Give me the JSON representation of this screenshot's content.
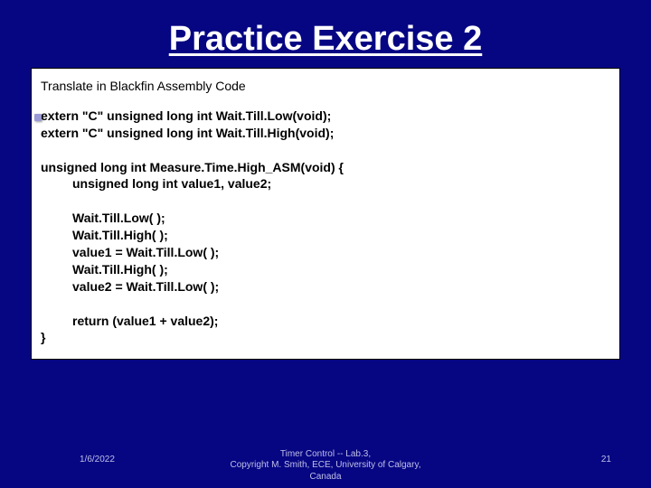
{
  "title": "Practice Exercise 2",
  "instruction": "Translate in Blackfin Assembly Code",
  "code": "extern \"C\" unsigned long int Wait.Till.Low(void);\nextern \"C\" unsigned long int Wait.Till.High(void);\n\nunsigned long int Measure.Time.High_ASM(void) {\n         unsigned long int value1, value2;\n\n         Wait.Till.Low( );\n         Wait.Till.High( );\n         value1 = Wait.Till.Low( );\n         Wait.Till.High( );\n         value2 = Wait.Till.Low( );\n\n         return (value1 + value2);\n}",
  "footer": {
    "date": "1/6/2022",
    "center_line1": "Timer Control -- Lab.3,",
    "center_line2": "Copyright M. Smith, ECE, University of Calgary,",
    "center_line3": "Canada",
    "page": "21"
  }
}
